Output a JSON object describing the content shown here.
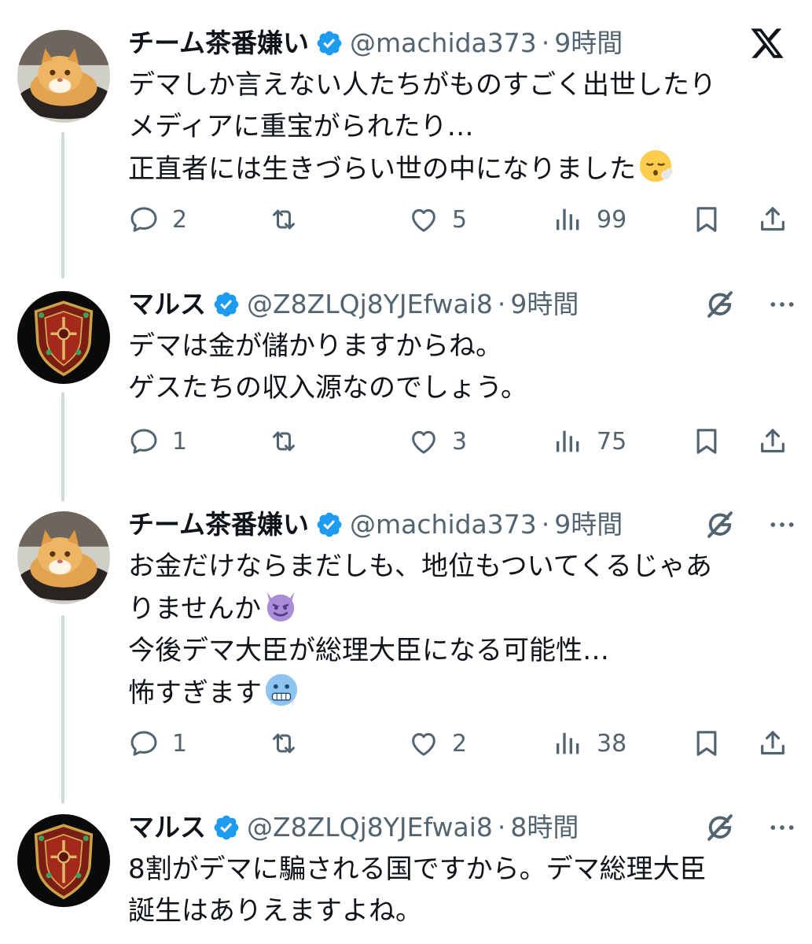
{
  "posts": [
    {
      "display_name": "チーム茶番嫌い",
      "handle": "@machida373",
      "separator": "·",
      "time": "9時間",
      "avatar": "cat-avatar",
      "lines": [
        "デマしか言えない人たちがものすごく出世したり",
        "メディアに重宝がられたり…",
        "正直者には生きづらい世の中になりました"
      ],
      "emoji": "face-exhaling",
      "top_icons": [
        "x-logo"
      ],
      "replies": "2",
      "reposts": "",
      "likes": "5",
      "views": "99"
    },
    {
      "display_name": "マルス",
      "handle": "@Z8ZLQj8YJEfwai8",
      "separator": "·",
      "time": "9時間",
      "avatar": "shield-avatar",
      "lines": [
        "デマは金が儲かりますからね。",
        "ゲスたちの収入源なのでしょう。"
      ],
      "top_icons": [
        "grok-icon",
        "more-icon"
      ],
      "replies": "1",
      "reposts": "",
      "likes": "3",
      "views": "75"
    },
    {
      "display_name": "チーム茶番嫌い",
      "handle": "@machida373",
      "separator": "·",
      "time": "9時間",
      "avatar": "cat-avatar",
      "lines": [
        "お金だけならまだしも、地位もついてくるじゃあ",
        "りませんか",
        "今後デマ大臣が総理大臣になる可能性…",
        "怖すぎます"
      ],
      "emoji_line_2": "smiling-face-with-horns",
      "emoji_line_4": "cold-face",
      "top_icons": [
        "grok-icon",
        "more-icon"
      ],
      "replies": "1",
      "reposts": "",
      "likes": "2",
      "views": "38"
    },
    {
      "display_name": "マルス",
      "handle": "@Z8ZLQj8YJEfwai8",
      "separator": "·",
      "time": "8時間",
      "avatar": "shield-avatar",
      "lines": [
        "8割がデマに騙される国ですから。デマ総理大臣",
        "誕生はありえますよね。"
      ],
      "top_icons": [
        "grok-icon",
        "more-icon"
      ]
    }
  ],
  "colors": {
    "verified": "#1d9bf0",
    "muted": "#536471",
    "text": "#0f1419",
    "thread_line": "#cfd9de"
  }
}
